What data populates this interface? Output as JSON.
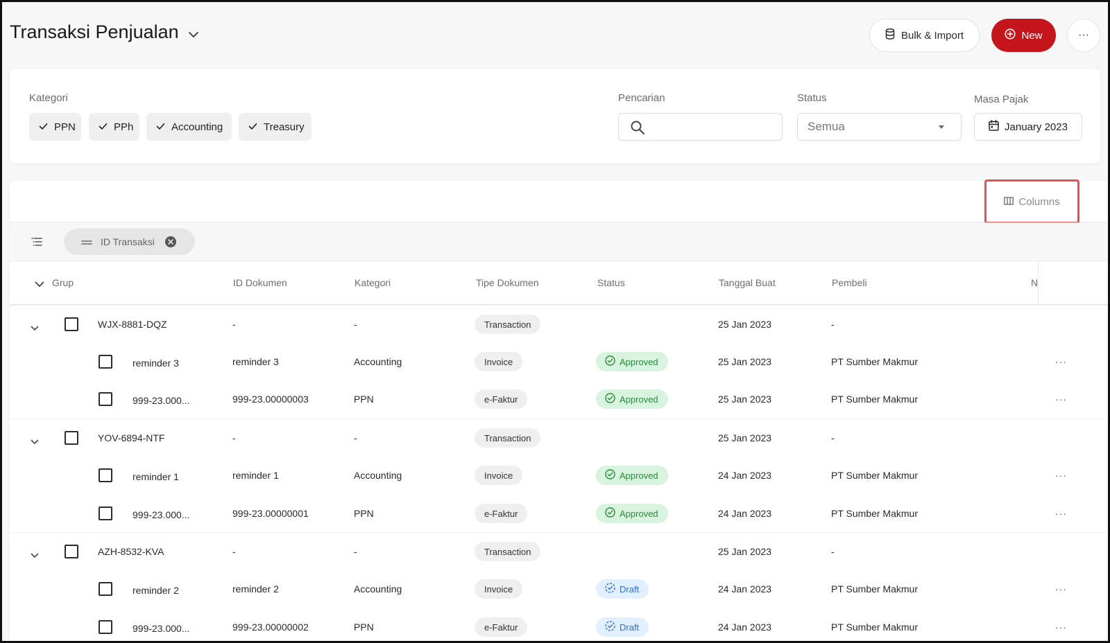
{
  "header": {
    "title": "Transaksi Penjualan",
    "bulk_label": "Bulk & Import",
    "new_label": "New",
    "more_label": "···"
  },
  "filters": {
    "kategori_label": "Kategori",
    "chips": [
      "PPN",
      "PPh",
      "Accounting",
      "Treasury"
    ],
    "search_label": "Pencarian",
    "search_value": "",
    "status_label": "Status",
    "status_value": "Semua",
    "masa_label": "Masa Pajak",
    "masa_value": "January 2023"
  },
  "toolbar": {
    "columns_label": "Columns",
    "group_chip_label": "ID Transaksi"
  },
  "table": {
    "headers": {
      "grup": "Grup",
      "id_dokumen": "ID Dokumen",
      "kategori": "Kategori",
      "tipe": "Tipe Dokumen",
      "status": "Status",
      "tanggal": "Tanggal Buat",
      "pembeli": "Pembeli",
      "cut": "N"
    },
    "rows": [
      {
        "kind": "group",
        "name": "WJX-8881-DQZ",
        "id": "-",
        "kategori": "-",
        "tipe": "Transaction",
        "status": "",
        "tanggal": "25 Jan 2023",
        "pembeli": "-"
      },
      {
        "kind": "child",
        "name": "reminder 3",
        "id": "reminder 3",
        "kategori": "Accounting",
        "tipe": "Invoice",
        "status": "Approved",
        "tanggal": "25 Jan 2023",
        "pembeli": "PT Sumber Makmur"
      },
      {
        "kind": "child",
        "name": "999-23.000...",
        "id": "999-23.00000003",
        "kategori": "PPN",
        "tipe": "e-Faktur",
        "status": "Approved",
        "tanggal": "25 Jan 2023",
        "pembeli": "PT Sumber Makmur"
      },
      {
        "kind": "group",
        "name": "YOV-6894-NTF",
        "id": "-",
        "kategori": "-",
        "tipe": "Transaction",
        "status": "",
        "tanggal": "25 Jan 2023",
        "pembeli": "-"
      },
      {
        "kind": "child",
        "name": "reminder 1",
        "id": "reminder 1",
        "kategori": "Accounting",
        "tipe": "Invoice",
        "status": "Approved",
        "tanggal": "24 Jan 2023",
        "pembeli": "PT Sumber Makmur"
      },
      {
        "kind": "child",
        "name": "999-23.000...",
        "id": "999-23.00000001",
        "kategori": "PPN",
        "tipe": "e-Faktur",
        "status": "Approved",
        "tanggal": "24 Jan 2023",
        "pembeli": "PT Sumber Makmur"
      },
      {
        "kind": "group",
        "name": "AZH-8532-KVA",
        "id": "-",
        "kategori": "-",
        "tipe": "Transaction",
        "status": "",
        "tanggal": "25 Jan 2023",
        "pembeli": "-"
      },
      {
        "kind": "child",
        "name": "reminder 2",
        "id": "reminder 2",
        "kategori": "Accounting",
        "tipe": "Invoice",
        "status": "Draft",
        "tanggal": "24 Jan 2023",
        "pembeli": "PT Sumber Makmur"
      },
      {
        "kind": "child",
        "name": "999-23.000...",
        "id": "999-23.00000002",
        "kategori": "PPN",
        "tipe": "e-Faktur",
        "status": "Draft",
        "tanggal": "24 Jan 2023",
        "pembeli": "PT Sumber Makmur"
      }
    ],
    "row_more_label": "···"
  },
  "colors": {
    "brand_red": "#c4161c",
    "approved_bg": "#d8f3de",
    "approved_fg": "#2a8a3c",
    "draft_bg": "#e1efff",
    "draft_fg": "#2f6fd2",
    "highlight": "#e0534f"
  }
}
